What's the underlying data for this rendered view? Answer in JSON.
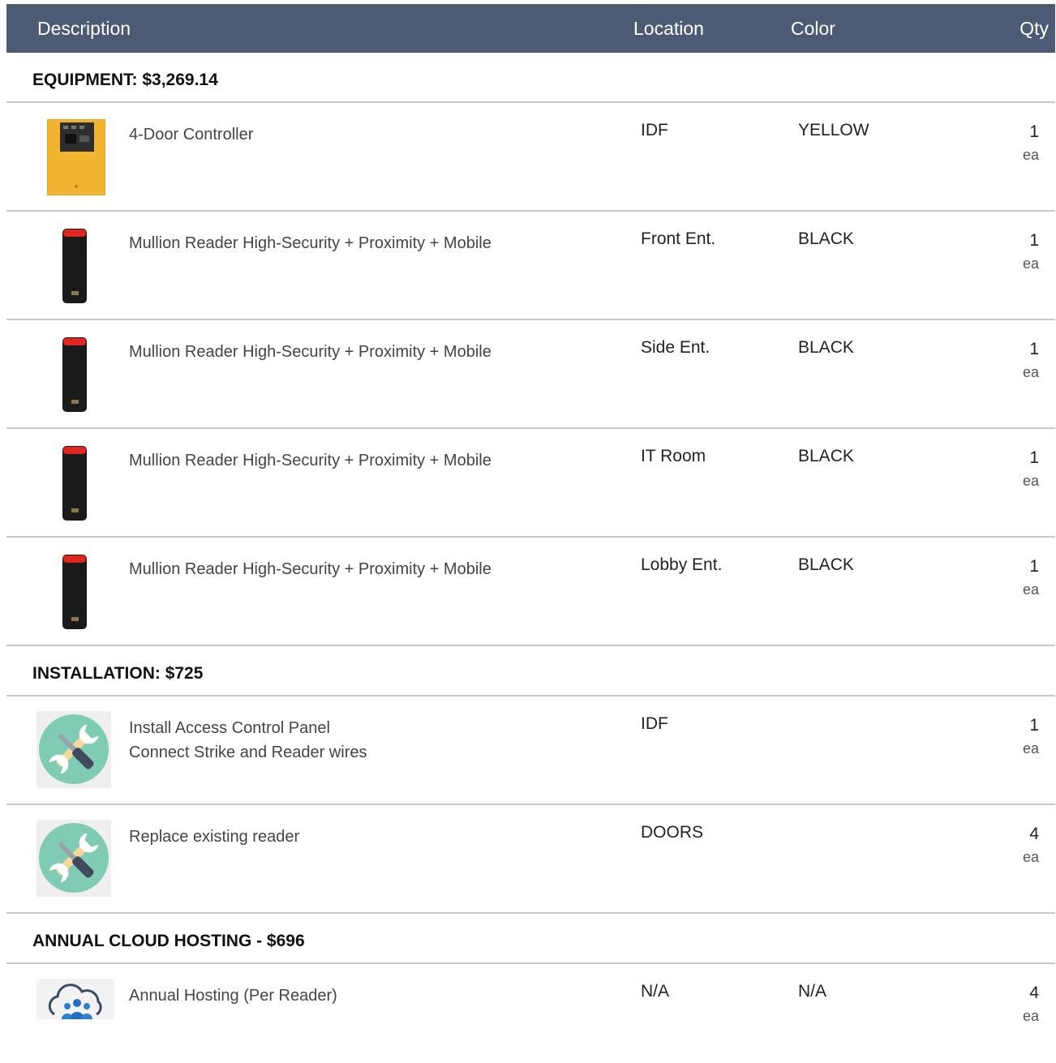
{
  "header": {
    "description": "Description",
    "location": "Location",
    "color": "Color",
    "qty": "Qty"
  },
  "sections": {
    "equipment": {
      "title": "EQUIPMENT: $3,269.14",
      "rows": [
        {
          "icon": "controller-panel-icon",
          "description": "4-Door Controller",
          "location": "IDF",
          "color": "YELLOW",
          "qty": "1",
          "unit": "ea"
        },
        {
          "icon": "card-reader-icon",
          "description": "Mullion Reader High-Security + Proximity + Mobile",
          "location": "Front Ent.",
          "color": "BLACK",
          "qty": "1",
          "unit": "ea"
        },
        {
          "icon": "card-reader-icon",
          "description": "Mullion Reader High-Security + Proximity + Mobile",
          "location": "Side Ent.",
          "color": "BLACK",
          "qty": "1",
          "unit": "ea"
        },
        {
          "icon": "card-reader-icon",
          "description": "Mullion Reader High-Security + Proximity + Mobile",
          "location": "IT Room",
          "color": "BLACK",
          "qty": "1",
          "unit": "ea"
        },
        {
          "icon": "card-reader-icon",
          "description": "Mullion Reader High-Security + Proximity + Mobile",
          "location": "Lobby Ent.",
          "color": "BLACK",
          "qty": "1",
          "unit": "ea"
        }
      ]
    },
    "installation": {
      "title": "INSTALLATION: $725",
      "rows": [
        {
          "icon": "tools-icon",
          "description_line1": "Install Access Control Panel",
          "description_line2": "Connect Strike and Reader wires",
          "location": "IDF",
          "qty": "1",
          "unit": "ea"
        },
        {
          "icon": "tools-icon",
          "description": "Replace existing reader",
          "location": "DOORS",
          "qty": "4",
          "unit": "ea"
        }
      ]
    },
    "hosting": {
      "title": "ANNUAL CLOUD HOSTING - $696",
      "rows": [
        {
          "icon": "cloud-users-icon",
          "description": "Annual Hosting (Per Reader)",
          "location": "N/A",
          "color": "N/A",
          "qty": "4",
          "unit": "ea"
        }
      ]
    }
  },
  "colors": {
    "header_bg": "#4d5a74",
    "divider": "#c9c9c9",
    "controller_yellow": "#f2b531",
    "reader_red": "#e0261e",
    "tools_teal": "#7fcbb3"
  }
}
